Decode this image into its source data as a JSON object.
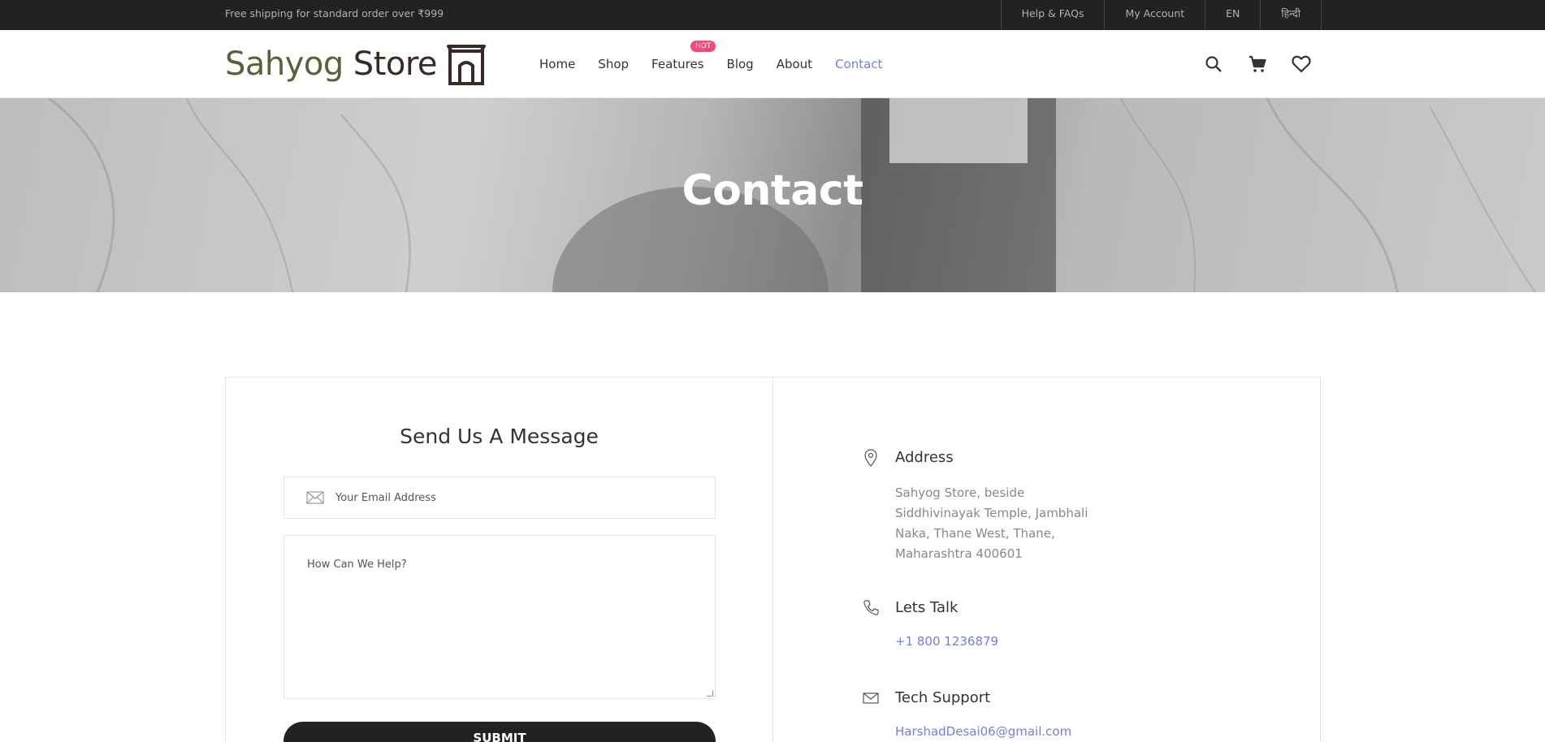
{
  "topbar": {
    "shipping_text": "Free shipping for standard order over ₹999",
    "links": [
      "Help & FAQs",
      "My Account",
      "EN",
      "हिन्दी"
    ]
  },
  "header": {
    "logo_word1": "Sahyog",
    "logo_word2": "Store",
    "nav": [
      {
        "label": "Home",
        "active": false
      },
      {
        "label": "Shop",
        "active": false
      },
      {
        "label": "Features",
        "active": false,
        "badge": "HOT"
      },
      {
        "label": "Blog",
        "active": false
      },
      {
        "label": "About",
        "active": false
      },
      {
        "label": "Contact",
        "active": true
      }
    ],
    "icons": [
      "search-icon",
      "cart-icon",
      "heart-icon"
    ]
  },
  "hero": {
    "title": "Contact"
  },
  "form": {
    "title": "Send Us A Message",
    "email_placeholder": "Your Email Address",
    "message_placeholder": "How Can We Help?",
    "submit_label": "SUBMIT"
  },
  "info": {
    "address_title": "Address",
    "address_lines": [
      "Sahyog Store, beside",
      "Siddhivinayak Temple, Jambhali",
      "Naka, Thane West, Thane,",
      "Maharashtra 400601"
    ],
    "talk_title": "Lets Talk",
    "phone": "+1 800 1236879",
    "support_title": "Tech Support",
    "email": "HarshadDesai06@gmail.com"
  },
  "colors": {
    "accent": "#717fe0",
    "hot_badge": "#f74877",
    "topbar_bg": "#222222",
    "button_bg": "#222222"
  }
}
